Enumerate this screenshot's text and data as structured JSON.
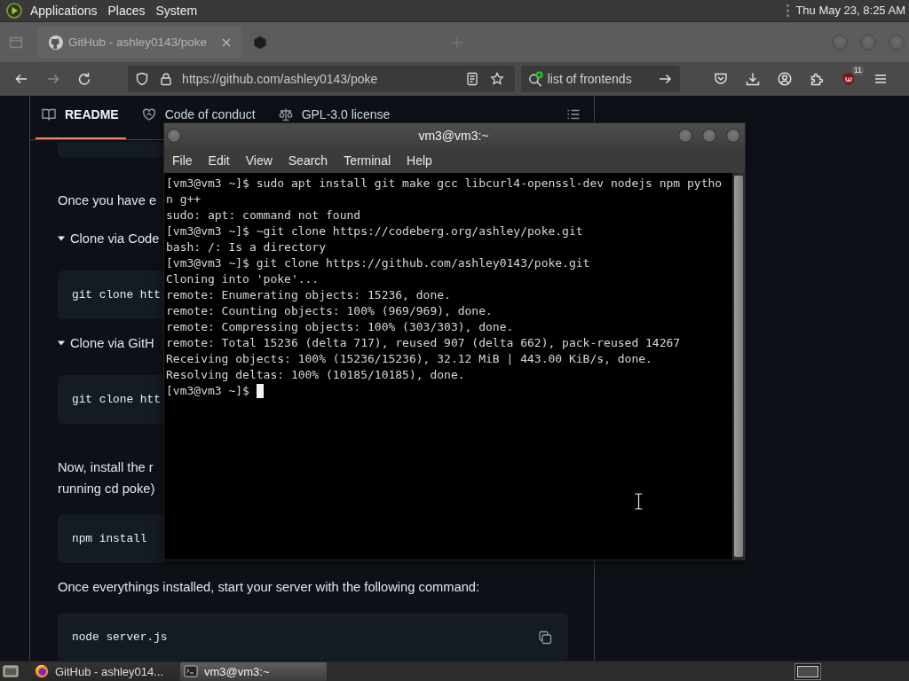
{
  "top_panel": {
    "menus": [
      "Applications",
      "Places",
      "System"
    ],
    "clock": "Thu May 23, 8:25 AM"
  },
  "browser": {
    "tabs": [
      {
        "title": "GitHub - ashley0143/poke",
        "selected": true
      },
      {
        "selected": false
      }
    ],
    "nav": [
      {
        "kind": "back",
        "disabled": false
      },
      {
        "kind": "forward",
        "disabled": true
      },
      {
        "kind": "reload",
        "disabled": false
      }
    ],
    "url": "https://github.com/ashley0143/poke",
    "search": {
      "value": "list of frontends"
    },
    "extension_badge": "11"
  },
  "readme": {
    "tabs": [
      {
        "label": "README",
        "selected": true
      },
      {
        "label": "Code of conduct",
        "selected": false
      },
      {
        "label": "GPL-3.0 license",
        "selected": false
      }
    ],
    "blocks": [
      {
        "kind": "code_fragment"
      },
      {
        "kind": "paragraph",
        "text": "Once you have e"
      },
      {
        "kind": "details",
        "text": "Clone via Code",
        "expanded": true
      },
      {
        "kind": "code_partial",
        "text": "git clone htt"
      },
      {
        "kind": "details",
        "text": "Clone via GitH",
        "expanded": true
      },
      {
        "kind": "code_partial",
        "text": "git clone htt"
      },
      {
        "kind": "paragraph",
        "lines": [
          "Now, install the r",
          "running cd poke)"
        ]
      },
      {
        "kind": "code_partial",
        "text": "npm install"
      },
      {
        "kind": "paragraph",
        "text": "Once everythings installed, start your server with the following command:"
      },
      {
        "kind": "code",
        "text": "node server.js"
      }
    ]
  },
  "terminal": {
    "title": "vm3@vm3:~",
    "menu": [
      "File",
      "Edit",
      "View",
      "Search",
      "Terminal",
      "Help"
    ],
    "lines": [
      "[vm3@vm3 ~]$ sudo apt install git make gcc libcurl4-openssl-dev nodejs npm pytho",
      "n g++",
      "sudo: apt: command not found",
      "[vm3@vm3 ~]$ ~git clone https://codeberg.org/ashley/poke.git",
      "bash: /: Is a directory",
      "[vm3@vm3 ~]$ git clone https://github.com/ashley0143/poke.git",
      "Cloning into 'poke'...",
      "remote: Enumerating objects: 15236, done.",
      "remote: Counting objects: 100% (969/969), done.",
      "remote: Compressing objects: 100% (303/303), done.",
      "remote: Total 15236 (delta 717), reused 907 (delta 662), pack-reused 14267",
      "Receiving objects: 100% (15236/15236), 32.12 MiB | 443.00 KiB/s, done.",
      "Resolving deltas: 100% (10185/10185), done.",
      "[vm3@vm3 ~]$"
    ],
    "cursor": true
  },
  "taskbar": {
    "items": [
      {
        "kind": "browser",
        "title": "GitHub - ashley014...",
        "selected": false
      },
      {
        "kind": "terminal",
        "title": "vm3@vm3:~",
        "selected": true
      }
    ]
  }
}
